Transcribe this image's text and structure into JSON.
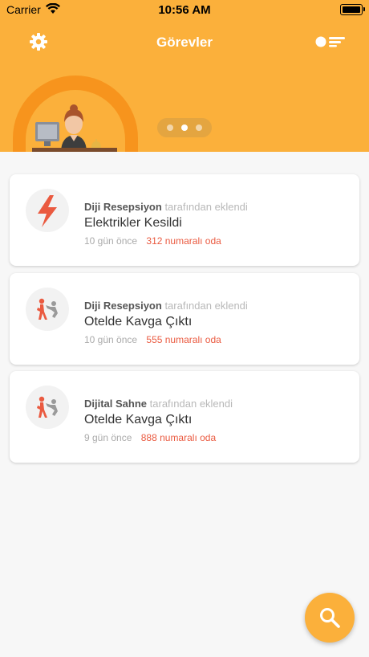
{
  "status_bar": {
    "carrier": "Carrier",
    "time": "10:56 AM"
  },
  "header": {
    "title": "Görevler"
  },
  "colors": {
    "accent": "#fbb03b",
    "accent_dark": "#f7941d",
    "room": "#ea5a40"
  },
  "pager": {
    "count": 3,
    "active_index": 1
  },
  "tasks": [
    {
      "author": "Diji Resepsiyon",
      "added_by_suffix": "tarafından eklendi",
      "title": "Elektrikler Kesildi",
      "time_ago": "10 gün önce",
      "room": "312 numaralı oda",
      "icon": "lightning-icon"
    },
    {
      "author": "Diji Resepsiyon",
      "added_by_suffix": "tarafından eklendi",
      "title": "Otelde Kavga Çıktı",
      "time_ago": "10 gün önce",
      "room": "555 numaralı oda",
      "icon": "fight-icon"
    },
    {
      "author": "Dijital Sahne",
      "added_by_suffix": "tarafından eklendi",
      "title": "Otelde Kavga Çıktı",
      "time_ago": "9 gün önce",
      "room": "888 numaralı oda",
      "icon": "fight-icon"
    }
  ],
  "icons": {
    "settings": "gear-icon",
    "filter": "filter-icon",
    "search": "search-icon"
  }
}
